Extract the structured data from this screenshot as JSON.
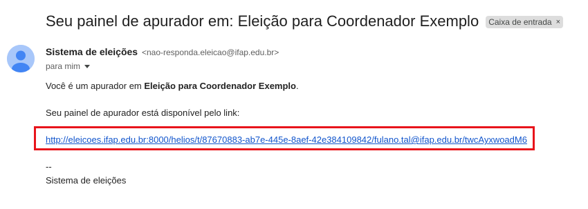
{
  "email": {
    "subject": "Seu painel de apurador em: Eleição para Coordenador Exemplo",
    "label_chip": "Caixa de entrada",
    "label_chip_close": "×",
    "sender_name": "Sistema de eleições",
    "sender_email": "<nao-responda.eleicao@ifap.edu.br>",
    "recipient": "para mim",
    "body": {
      "line1_prefix": "Você é um apurador em ",
      "line1_bold": "Eleição para Coordenador Exemplo",
      "line1_suffix": ".",
      "line2": "Seu painel de apurador está disponível pelo link:",
      "link": "http://eleicoes.ifap.edu.br:8000/helios/t/87670883-ab7e-445e-8aef-42e384109842/fulano.tal@ifap.edu.br/twcAyxwoadM6",
      "signature_sep": "--",
      "signature": "Sistema de eleições"
    }
  },
  "colors": {
    "highlight_border": "#e8141b",
    "link": "#1155cc",
    "avatar_bg": "#a8c7fa",
    "avatar_fg": "#4285f4"
  }
}
